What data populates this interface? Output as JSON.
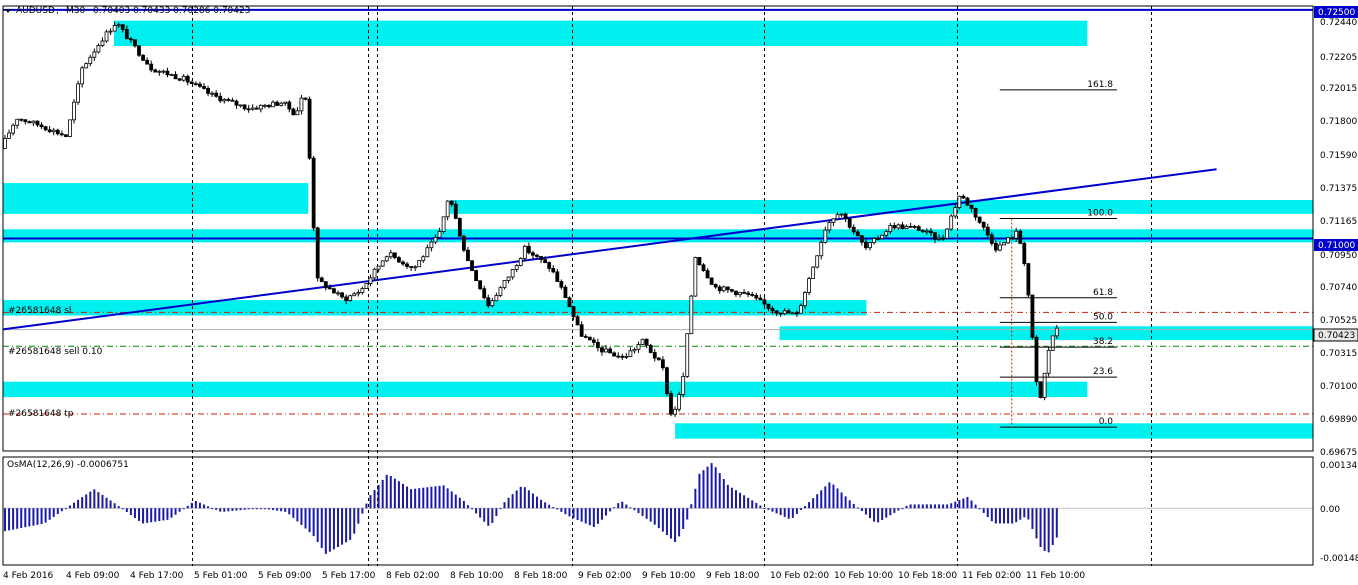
{
  "header": {
    "symbol": "AUDUSD",
    "timeframe": "M30",
    "ohlc": "0.70403 0.70433 0.70286 0.70423"
  },
  "osma_header": "OsMA(12,26,9) -0.0006751",
  "price_tags": {
    "top": "0.72500",
    "mid": "0.71000",
    "current": "0.70423"
  },
  "colors": {
    "zone": "#00f0f0",
    "trendline": "#0000cc",
    "bull": "#ffffff",
    "bear": "#000000",
    "osma": "#1a1aa6",
    "fib": "#000000",
    "order_sl": "#cc2200",
    "order_entry": "#008800",
    "order_tp": "#cc2200",
    "vgrid": "#000000",
    "current_tag": "#e8e8e8"
  },
  "order_labels": {
    "sl": "#26581648 sl",
    "entry": "#26581648 sell 0.10",
    "tp": "#26581648 tp"
  },
  "chart_data": {
    "type": "candlestick",
    "title": "AUDUSD,M30",
    "x_ticks": [
      "4 Feb 2016",
      "4 Feb 09:00",
      "4 Feb 17:00",
      "5 Feb 01:00",
      "5 Feb 09:00",
      "5 Feb 17:00",
      "8 Feb 02:00",
      "8 Feb 10:00",
      "8 Feb 18:00",
      "9 Feb 02:00",
      "9 Feb 10:00",
      "9 Feb 18:00",
      "10 Feb 02:00",
      "10 Feb 10:00",
      "10 Feb 18:00",
      "11 Feb 02:00",
      "11 Feb 10:00"
    ],
    "y_ticks": [
      "0.72440",
      "0.72205",
      "0.72015",
      "0.71800",
      "0.71590",
      "0.71375",
      "0.71165",
      "0.70950",
      "0.70740",
      "0.70525",
      "0.70315",
      "0.70100",
      "0.69890",
      "0.69675"
    ],
    "ylim": [
      0.69635,
      0.72525
    ],
    "fib_levels": [
      {
        "label": "161.8",
        "price": 0.7198
      },
      {
        "label": "100.0",
        "price": 0.71145
      },
      {
        "label": "61.8",
        "price": 0.7063
      },
      {
        "label": "50.0",
        "price": 0.7047
      },
      {
        "label": "38.2",
        "price": 0.7031
      },
      {
        "label": "23.6",
        "price": 0.70115
      },
      {
        "label": "0.0",
        "price": 0.6979
      }
    ],
    "zones": [
      {
        "x0": 0.0847,
        "x1": 0.8277,
        "p0": 0.72265,
        "p1": 0.7243
      },
      {
        "x0": 0.0,
        "x1": 0.233,
        "p0": 0.71175,
        "p1": 0.71375
      },
      {
        "x0": 0.3412,
        "x1": 1.0,
        "p0": 0.71175,
        "p1": 0.71265
      },
      {
        "x0": 0.0,
        "x1": 1.0,
        "p0": 0.7099,
        "p1": 0.71075
      },
      {
        "x0": 0.0,
        "x1": 0.6591,
        "p0": 0.70515,
        "p1": 0.70615
      },
      {
        "x0": 0.5928,
        "x1": 1.0,
        "p0": 0.70355,
        "p1": 0.70445
      },
      {
        "x0": 0.0,
        "x1": 0.8277,
        "p0": 0.69985,
        "p1": 0.70085
      },
      {
        "x0": 0.5131,
        "x1": 1.0,
        "p0": 0.69715,
        "p1": 0.69815
      }
    ],
    "hlines": {
      "top": 0.725,
      "blue": 0.71015
    },
    "order_levels": {
      "sl": 0.70535,
      "entry": 0.70315,
      "tp": 0.69875,
      "current": 0.70423
    },
    "trendline": {
      "x0": 0.0,
      "p0": 0.70425,
      "x1": 0.9264,
      "p1": 0.71465
    },
    "osma": {
      "ylim": [
        -0.0014872,
        0.001342
      ],
      "ticks": [
        "0.001342",
        "0.00",
        "-0.001487"
      ],
      "last": -0.0006751
    },
    "vgrid_pos": [
      0.144,
      0.279,
      0.2854,
      0.4341,
      0.5806,
      0.7284,
      0.876
    ]
  }
}
